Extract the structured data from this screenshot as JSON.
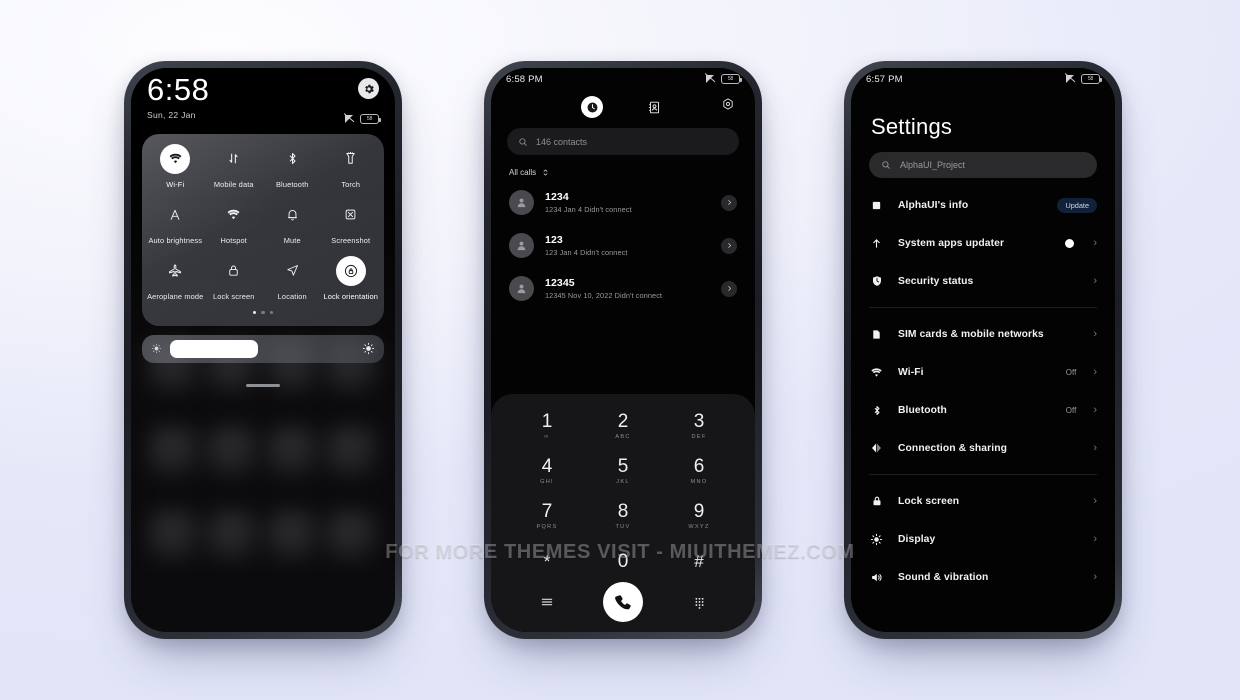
{
  "watermark": "FOR MORE THEMES VISIT - MIUITHEMEZ.COM",
  "colors": {
    "background": "#e4e6f8",
    "accent_badge": "#11213a",
    "tile_on": "#ffffff"
  },
  "phone1": {
    "statusbar": {
      "mute_icon": "mute-icon",
      "battery_label": "58"
    },
    "clock": "6:58",
    "date": "Sun, 22 Jan",
    "gear_icon": "gear-icon",
    "tiles": [
      {
        "label": "Wi-Fi",
        "icon": "wifi-icon",
        "state": "on",
        "arrow": true
      },
      {
        "label": "Mobile data",
        "icon": "mobile-data-icon",
        "state": "off",
        "arrow": false
      },
      {
        "label": "Bluetooth",
        "icon": "bluetooth-icon",
        "state": "off",
        "arrow": true
      },
      {
        "label": "Torch",
        "icon": "torch-icon",
        "state": "off",
        "arrow": false
      },
      {
        "label": "Auto brightness",
        "icon": "auto-brightness-icon",
        "state": "off",
        "arrow": false
      },
      {
        "label": "Hotspot",
        "icon": "hotspot-icon",
        "state": "off",
        "arrow": false
      },
      {
        "label": "Mute",
        "icon": "bell-icon",
        "state": "off",
        "arrow": false
      },
      {
        "label": "Screenshot",
        "icon": "screenshot-icon",
        "state": "off",
        "arrow": false
      },
      {
        "label": "Aeroplane mode",
        "icon": "airplane-icon",
        "state": "off",
        "arrow": false
      },
      {
        "label": "Lock screen",
        "icon": "padlock-icon",
        "state": "off",
        "arrow": false
      },
      {
        "label": "Location",
        "icon": "location-icon",
        "state": "off",
        "arrow": false
      },
      {
        "label": "Lock orientation",
        "icon": "lock-orientation-icon",
        "state": "on",
        "arrow": false
      }
    ],
    "page_dots": {
      "count": 3,
      "active": 0
    },
    "brightness": {
      "low_icon": "brightness-low-icon",
      "high_icon": "brightness-high-icon",
      "level_percent": 47
    }
  },
  "phone2": {
    "statusbar": {
      "time": "6:58 PM",
      "mute_icon": "mute-icon",
      "battery_label": "58"
    },
    "tabs": [
      {
        "name": "recents",
        "icon": "clock-icon",
        "selected": true
      },
      {
        "name": "contacts",
        "icon": "contacts-book-icon",
        "selected": false
      }
    ],
    "settings_icon": "gear-icon",
    "search": {
      "icon": "search-icon",
      "placeholder": "146 contacts"
    },
    "filter": {
      "label": "All calls",
      "icon": "sort-updown-icon"
    },
    "calls": [
      {
        "name": "1234",
        "detail": "1234  Jan 4 Didn't connect",
        "avatar": "person-icon",
        "chevron": "chevron-right-icon"
      },
      {
        "name": "123",
        "detail": "123  Jan 4 Didn't connect",
        "avatar": "person-icon",
        "chevron": "chevron-right-icon"
      },
      {
        "name": "12345",
        "detail": "12345  Nov 10, 2022 Didn't connect",
        "avatar": "person-icon",
        "chevron": "chevron-right-icon"
      }
    ],
    "keypad": [
      {
        "digit": "1",
        "letters": "∞"
      },
      {
        "digit": "2",
        "letters": "ABC"
      },
      {
        "digit": "3",
        "letters": "DEF"
      },
      {
        "digit": "4",
        "letters": "GHI"
      },
      {
        "digit": "5",
        "letters": "JKL"
      },
      {
        "digit": "6",
        "letters": "MNO"
      },
      {
        "digit": "7",
        "letters": "PQRS"
      },
      {
        "digit": "8",
        "letters": "TUV"
      },
      {
        "digit": "9",
        "letters": "WXYZ"
      },
      {
        "digit": "*",
        "letters": ""
      },
      {
        "digit": "0",
        "letters": "+"
      },
      {
        "digit": "#",
        "letters": ""
      }
    ],
    "actions": {
      "menu_icon": "menu-lines-icon",
      "call_icon": "phone-handset-icon",
      "keypad_icon": "dialpad-grid-icon"
    }
  },
  "phone3": {
    "statusbar": {
      "time": "6:57 PM",
      "mute_icon": "mute-icon",
      "battery_label": "58"
    },
    "title": "Settings",
    "search": {
      "icon": "search-icon",
      "placeholder": "AlphaUI_Project"
    },
    "groups": [
      {
        "rows": [
          {
            "label": "AlphaUI's info",
            "icon": "square-info-icon",
            "badge": "Update",
            "value": "",
            "arrow": false,
            "dot": false
          },
          {
            "label": "System apps updater",
            "icon": "arrow-up-icon",
            "badge": "",
            "value": "",
            "arrow": true,
            "dot": true
          },
          {
            "label": "Security status",
            "icon": "shield-clock-icon",
            "badge": "",
            "value": "",
            "arrow": true,
            "dot": false
          }
        ]
      },
      {
        "rows": [
          {
            "label": "SIM cards & mobile networks",
            "icon": "sim-card-icon",
            "badge": "",
            "value": "",
            "arrow": true,
            "dot": false
          },
          {
            "label": "Wi-Fi",
            "icon": "wifi-icon",
            "badge": "",
            "value": "Off",
            "arrow": true,
            "dot": false
          },
          {
            "label": "Bluetooth",
            "icon": "bluetooth-icon",
            "badge": "",
            "value": "Off",
            "arrow": true,
            "dot": false
          },
          {
            "label": "Connection & sharing",
            "icon": "connection-sharing-icon",
            "badge": "",
            "value": "",
            "arrow": true,
            "dot": false
          }
        ]
      },
      {
        "rows": [
          {
            "label": "Lock screen",
            "icon": "padlock-icon",
            "badge": "",
            "value": "",
            "arrow": true,
            "dot": false
          },
          {
            "label": "Display",
            "icon": "sun-icon",
            "badge": "",
            "value": "",
            "arrow": true,
            "dot": false
          },
          {
            "label": "Sound & vibration",
            "icon": "speaker-icon",
            "badge": "",
            "value": "",
            "arrow": true,
            "dot": false
          }
        ]
      }
    ]
  }
}
